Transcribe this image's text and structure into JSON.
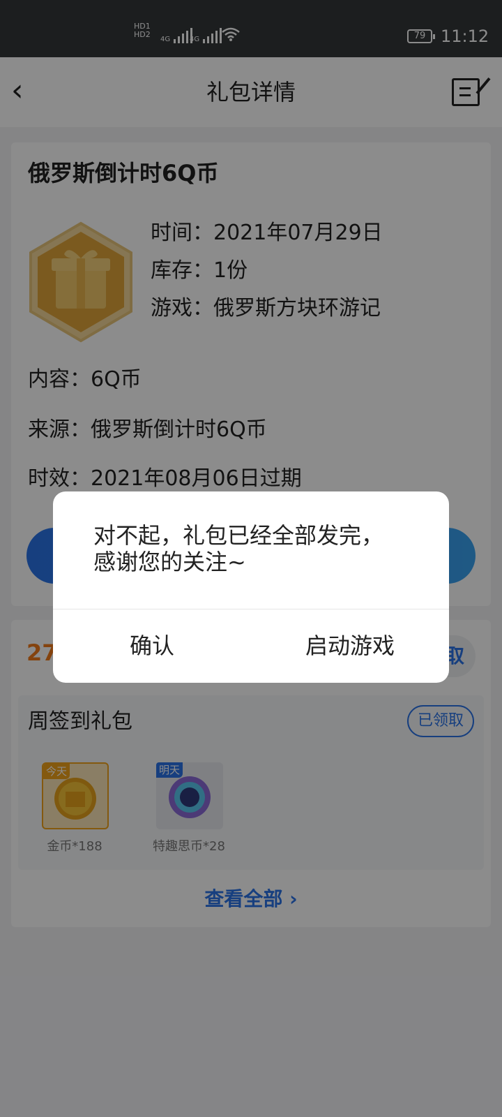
{
  "status": {
    "network1": "HD1",
    "network2": "HD2",
    "signal1": "4G",
    "signal2": "4G",
    "battery": "79",
    "time": "11:12"
  },
  "nav": {
    "title": "礼包详情"
  },
  "gift": {
    "name": "俄罗斯倒计时6Q币",
    "time": "时间：2021年07月29日",
    "stock": "库存：1份",
    "game": "游戏：俄罗斯方块环游记",
    "content": "内容：6Q币",
    "source": "来源：俄罗斯倒计时6Q币",
    "expiry": "时效：2021年08月06日过期"
  },
  "signin": {
    "count": "27",
    "get_label": "取",
    "title": "周签到礼包",
    "claimed": "已领取",
    "rewards": [
      {
        "tag": "今天",
        "label": "金币*188"
      },
      {
        "tag": "明天",
        "label": "特趣思币*28"
      }
    ],
    "view_all": "查看全部 ›"
  },
  "dialog": {
    "line1": "对不起，礼包已经全部发完，",
    "line2": "感谢您的关注~",
    "confirm": "确认",
    "launch": "启动游戏"
  },
  "colors": {
    "accent": "#2a73e8",
    "orange": "#f07a1a"
  }
}
